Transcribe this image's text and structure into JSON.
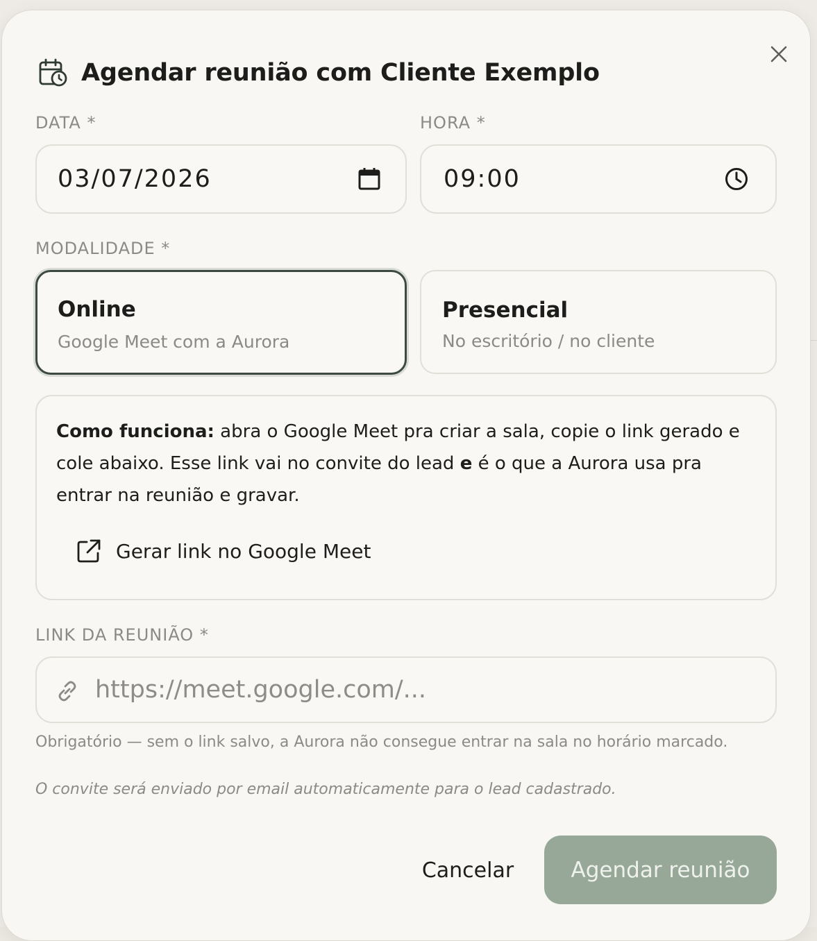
{
  "dialog": {
    "title": "Agendar reunião com Cliente Exemplo",
    "title_icon": "calendar-clock-icon",
    "close_icon": "close-icon"
  },
  "date": {
    "label": "DATA *",
    "value": "03/07/2026",
    "icon": "calendar-icon"
  },
  "time": {
    "label": "HORA *",
    "value": "09:00",
    "icon": "clock-icon"
  },
  "modality": {
    "label": "MODALIDADE *",
    "options": [
      {
        "title": "Online",
        "subtitle": "Google Meet com a Aurora",
        "selected": true
      },
      {
        "title": "Presencial",
        "subtitle": "No escritório / no cliente",
        "selected": false
      }
    ]
  },
  "info": {
    "bold_prefix": "Como funciona:",
    "text_part1": " abra o Google Meet pra criar a sala, copie o link gerado e cole abaixo. Esse link vai no convite do lead ",
    "bold_mid": "e",
    "text_part2": " é o que a Aurora usa pra entrar na reunião e gravar.",
    "action_label": "Gerar link no Google Meet",
    "action_icon": "external-link-icon"
  },
  "meeting_link": {
    "label": "LINK DA REUNIÃO *",
    "placeholder": "https://meet.google.com/...",
    "value": "",
    "icon": "link-icon",
    "helper": "Obrigatório — sem o link salvo, a Aurora não consegue entrar na sala no horário marcado."
  },
  "note": "O convite será enviado por email automaticamente para o lead cadastrado.",
  "actions": {
    "cancel_label": "Cancelar",
    "submit_label": "Agendar reunião"
  },
  "colors": {
    "background": "#f8f7f3",
    "border": "#e2dfd8",
    "selected_border": "#3d4a40",
    "primary_button": "#97a898",
    "muted_text": "#8b8a85"
  }
}
